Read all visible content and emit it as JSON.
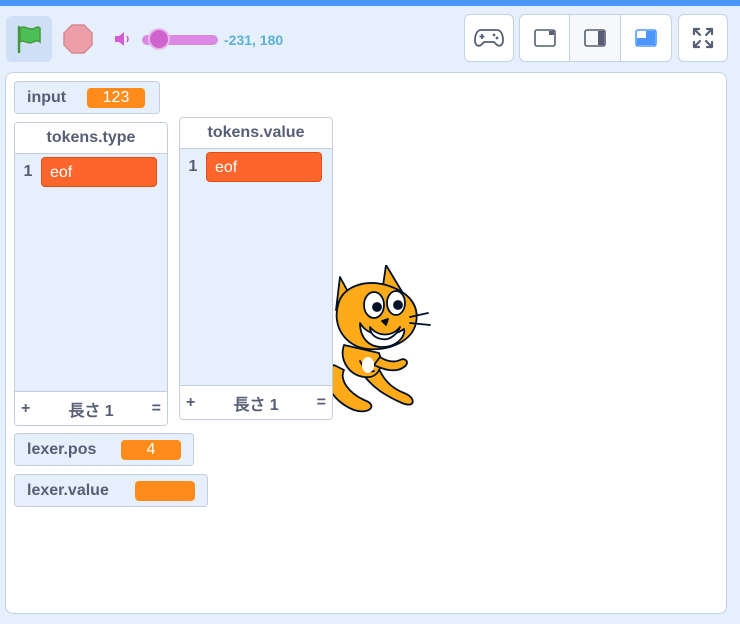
{
  "controls": {
    "coordinates": "-231, 180",
    "volume_fraction": 0.25
  },
  "icons": {
    "flag": "green-flag-icon",
    "stop": "stop-icon",
    "volume": "speaker-icon",
    "gamepad": "gamepad-icon",
    "small_stage": "small-stage-icon",
    "large_stage": "large-stage-icon",
    "layout": "layout-icon",
    "fullscreen": "fullscreen-icon"
  },
  "colors": {
    "accent": "#4c97ff",
    "variable": "#ff8c1a",
    "list_item": "#fc662c",
    "flag": "#4cbf56",
    "stop": "#ec9fa8"
  },
  "monitors": {
    "input": {
      "label": "input",
      "value": "123"
    },
    "lexer_pos": {
      "label": "lexer.pos",
      "value": "4"
    },
    "lexer_value": {
      "label": "lexer.value",
      "value": ""
    }
  },
  "lists": {
    "tokens_type": {
      "title": "tokens.type",
      "items": [
        {
          "index": "1",
          "value": "eof"
        }
      ],
      "add": "+",
      "length": "長さ 1",
      "resize": "="
    },
    "tokens_value": {
      "title": "tokens.value",
      "items": [
        {
          "index": "1",
          "value": "eof"
        }
      ],
      "add": "+",
      "length": "長さ 1",
      "resize": "="
    }
  }
}
